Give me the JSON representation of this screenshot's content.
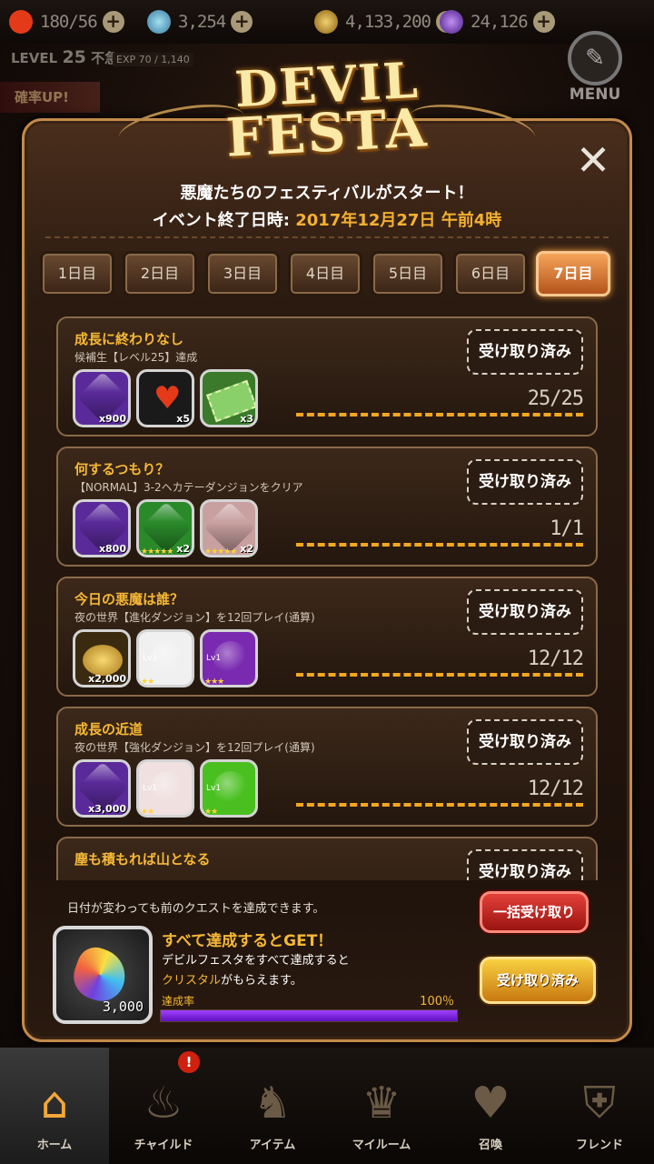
{
  "resources": [
    {
      "name": "heart",
      "value": "180/56",
      "color": "#e43a1a"
    },
    {
      "name": "orb",
      "value": "3,254",
      "color": "#6ab0d8"
    },
    {
      "name": "gold",
      "value": "4,133,200",
      "color": "#c89a30"
    },
    {
      "name": "crystal",
      "value": "24,126",
      "color": "#7a3ac8"
    }
  ],
  "player": {
    "level_label": "LEVEL",
    "level": "25",
    "status": "不急",
    "exp": "EXP 70 / 1,140"
  },
  "side_banner": "確率UP!",
  "menu_label": "MENU",
  "logo": {
    "line1": "DEVIL",
    "line2": "FESTA"
  },
  "header": {
    "headline": "悪魔たちのフェスティバルがスタート！",
    "end_label": "イベント終了日時: ",
    "end_date": "2017年12月27日 午前4時"
  },
  "tabs": [
    "1日目",
    "2日目",
    "3日目",
    "4日目",
    "5日目",
    "6日目",
    "7日目"
  ],
  "active_tab": 6,
  "quests": [
    {
      "title": "成長に終わりなし",
      "desc": "候補生【レベル25】達成",
      "claim": "受け取り済み",
      "progress": "25/25",
      "items": [
        {
          "kind": "gem",
          "color": "#5a2a9a",
          "qty": "x900"
        },
        {
          "kind": "heart",
          "color": "#1a1a1a",
          "qty": "x5"
        },
        {
          "kind": "ticket",
          "color": "#3a7a2a",
          "qty": "x3"
        }
      ]
    },
    {
      "title": "何するつもり？",
      "desc": "【NORMAL】3-2ヘカテーダンジョンをクリア",
      "claim": "受け取り済み",
      "progress": "1/1",
      "items": [
        {
          "kind": "gem",
          "color": "#5a2a9a",
          "qty": "x800"
        },
        {
          "kind": "gem",
          "color": "#2a8a2a",
          "qty": "x2",
          "stars": "★★★★★"
        },
        {
          "kind": "gem",
          "color": "#c8a0a0",
          "qty": "x2",
          "stars": "★★★★★"
        }
      ]
    },
    {
      "title": "今日の悪魔は誰？",
      "desc": "夜の世界【進化ダンジョン】を12回プレイ(通算)",
      "claim": "受け取り済み",
      "progress": "12/12",
      "items": [
        {
          "kind": "coins",
          "color": "#3a2a10",
          "qty": "x2,000"
        },
        {
          "kind": "blob",
          "color": "#f0f0f0",
          "qty": "",
          "stars": "★★",
          "lv": "Lv1"
        },
        {
          "kind": "blob",
          "color": "#7a2ab0",
          "qty": "",
          "stars": "★★★",
          "lv": "Lv1"
        }
      ]
    },
    {
      "title": "成長の近道",
      "desc": "夜の世界【強化ダンジョン】を12回プレイ(通算)",
      "claim": "受け取り済み",
      "progress": "12/12",
      "items": [
        {
          "kind": "gem",
          "color": "#5a2a9a",
          "qty": "x3,000"
        },
        {
          "kind": "blob",
          "color": "#f0e0e0",
          "qty": "",
          "stars": "★★",
          "lv": "Lv1"
        },
        {
          "kind": "blob",
          "color": "#4ac020",
          "qty": "",
          "stars": "★★",
          "lv": "Lv1"
        }
      ]
    },
    {
      "title": "塵も積もれば山となる",
      "desc": "",
      "claim": "受け取り済み",
      "progress": "",
      "items": []
    }
  ],
  "footer": {
    "note": "日付が変わっても前のクエストを達成できます。",
    "bulk_claim": "一括受け取り",
    "reward_qty": "3,000",
    "all_title": "すべて達成するとGET！",
    "all_desc_1": "デビルフェスタをすべて達成すると",
    "all_desc_hl": "クリスタル",
    "all_desc_2": "がもらえます。",
    "rate_label": "達成率",
    "rate_value": "100％",
    "rate_fraction": 1.0,
    "all_claim": "受け取り済み"
  },
  "nav": [
    {
      "label": "ホーム",
      "icon": "home-icon",
      "glyph": "⌂"
    },
    {
      "label": "チャイルド",
      "icon": "flame-icon",
      "glyph": "♨"
    },
    {
      "label": "アイテム",
      "icon": "knight-icon",
      "glyph": "♞"
    },
    {
      "label": "マイルーム",
      "icon": "crown-icon",
      "glyph": "♛"
    },
    {
      "label": "召喚",
      "icon": "summon-icon",
      "glyph": "♥"
    },
    {
      "label": "フレンド",
      "icon": "shield-icon",
      "glyph": "⛨"
    }
  ],
  "nav_badge": "!"
}
